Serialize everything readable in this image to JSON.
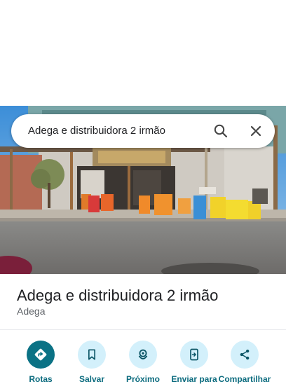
{
  "search": {
    "query": "Adega e distribuidora 2 irmão"
  },
  "place": {
    "name": "Adega e distribuidora 2 irmão",
    "category": "Adega"
  },
  "actions": [
    {
      "label": "Rotas",
      "icon": "directions-icon"
    },
    {
      "label": "Salvar",
      "icon": "bookmark-icon"
    },
    {
      "label": "Próximo",
      "icon": "nearby-icon"
    },
    {
      "label": "Enviar para",
      "icon": "send-to-phone-icon"
    },
    {
      "label": "Compartilhar",
      "icon": "share-icon"
    }
  ],
  "colors": {
    "accent": "#0b7285",
    "accent_light": "#d3f0fb"
  }
}
